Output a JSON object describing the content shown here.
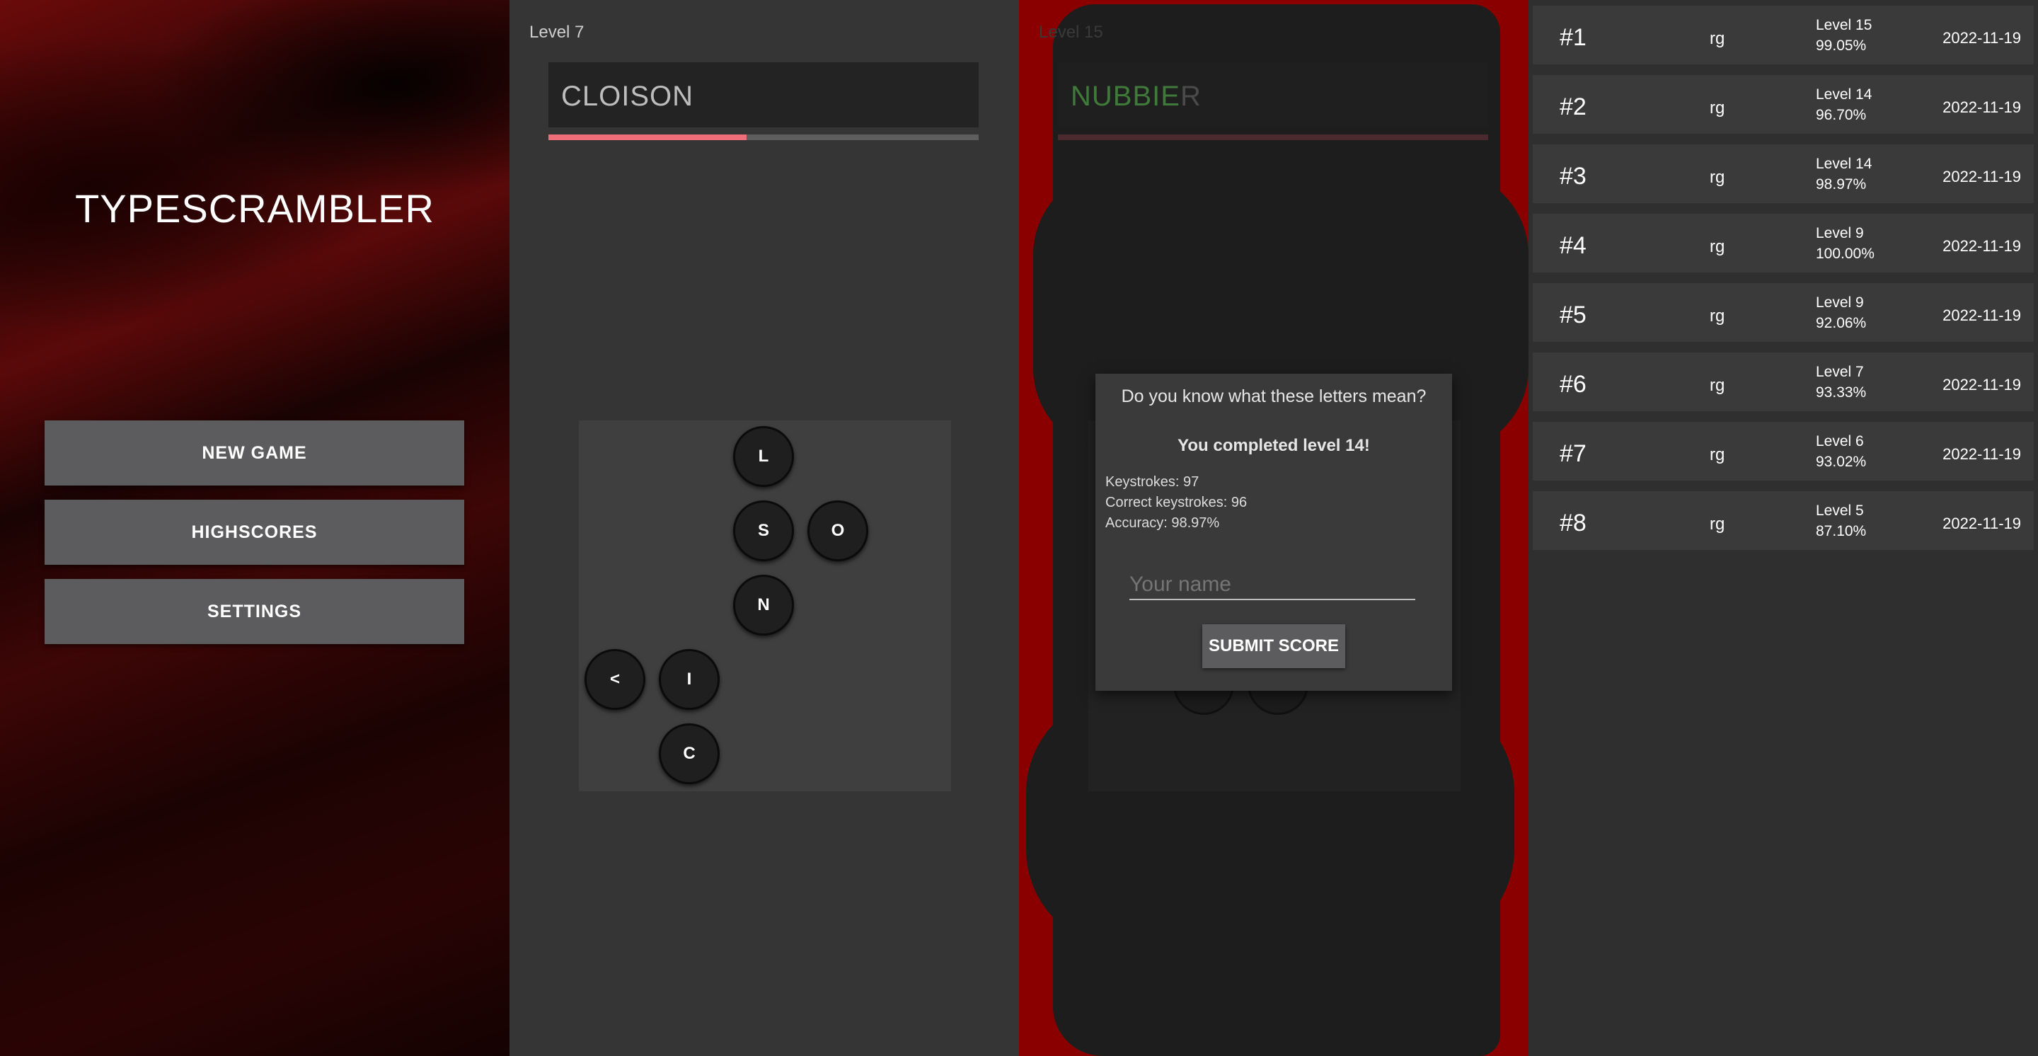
{
  "menu": {
    "title": "TYPESCRAMBLER",
    "buttons": [
      "NEW GAME",
      "HIGHSCORES",
      "SETTINGS"
    ]
  },
  "game": {
    "level": "Level 7",
    "word": "CLOISON",
    "progress": 0.46,
    "keys": [
      "L",
      "S",
      "O",
      "N",
      "<",
      "I",
      "C"
    ]
  },
  "game_over": {
    "level": "Level 15",
    "word_correct": "NUBBIE",
    "word_remaining": "R",
    "dialog": {
      "question": "Do you know what these letters mean?",
      "completed": "You completed level 14!",
      "keystrokes": "Keystrokes: 97",
      "correct_keystrokes": "Correct keystrokes: 96",
      "accuracy": "Accuracy: 98.97%",
      "name_placeholder": "Your name",
      "submit_label": "SUBMIT SCORE"
    }
  },
  "highscores": [
    {
      "rank": "#1",
      "name": "rg",
      "level": "Level 15",
      "accuracy": "99.05%",
      "date": "2022-11-19"
    },
    {
      "rank": "#2",
      "name": "rg",
      "level": "Level 14",
      "accuracy": "96.70%",
      "date": "2022-11-19"
    },
    {
      "rank": "#3",
      "name": "rg",
      "level": "Level 14",
      "accuracy": "98.97%",
      "date": "2022-11-19"
    },
    {
      "rank": "#4",
      "name": "rg",
      "level": "Level 9",
      "accuracy": "100.00%",
      "date": "2022-11-19"
    },
    {
      "rank": "#5",
      "name": "rg",
      "level": "Level 9",
      "accuracy": "92.06%",
      "date": "2022-11-19"
    },
    {
      "rank": "#6",
      "name": "rg",
      "level": "Level 7",
      "accuracy": "93.33%",
      "date": "2022-11-19"
    },
    {
      "rank": "#7",
      "name": "rg",
      "level": "Level 6",
      "accuracy": "93.02%",
      "date": "2022-11-19"
    },
    {
      "rank": "#8",
      "name": "rg",
      "level": "Level 5",
      "accuracy": "87.10%",
      "date": "2022-11-19"
    }
  ],
  "colors": {
    "accent": "#f06d7a",
    "correct_letter": "#3f7a3a",
    "background_red": "#8a0000",
    "button": "#5c5c5e"
  }
}
